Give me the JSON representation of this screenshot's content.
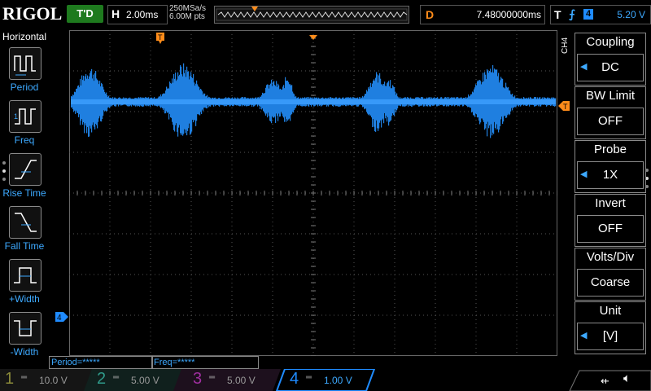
{
  "brand": "RIGOL",
  "run_state": "T'D",
  "horizontal": {
    "label": "H",
    "timebase": "2.00ms",
    "sample_rate": "250MSa/s",
    "points": "6.00M pts"
  },
  "delay": {
    "label": "D",
    "value": "7.48000000ms"
  },
  "trigger": {
    "label": "T",
    "edge_icon": "rising-edge-icon",
    "source": "4",
    "level": "5.20 V"
  },
  "left_menu": {
    "title": "Horizontal",
    "items": [
      {
        "label": "Period",
        "icon": "period-icon"
      },
      {
        "label": "Freq",
        "icon": "freq-icon"
      },
      {
        "label": "Rise Time",
        "icon": "rise-time-icon"
      },
      {
        "label": "Fall Time",
        "icon": "fall-time-icon"
      },
      {
        "label": "+Width",
        "icon": "pos-width-icon"
      },
      {
        "label": "-Width",
        "icon": "neg-width-icon"
      }
    ]
  },
  "right_menu": {
    "channel": "CH4",
    "items": [
      {
        "title": "Coupling",
        "value": "DC",
        "has_arrow": true
      },
      {
        "title": "BW Limit",
        "value": "OFF",
        "has_arrow": false
      },
      {
        "title": "Probe",
        "value": "1X",
        "has_arrow": true
      },
      {
        "title": "Invert",
        "value": "OFF",
        "has_arrow": false
      },
      {
        "title": "Volts/Div",
        "value": "Coarse",
        "has_arrow": false
      },
      {
        "title": "Unit",
        "value": "[V]",
        "has_arrow": true
      }
    ]
  },
  "measurements": [
    "Period=*****",
    "Freq=*****"
  ],
  "channels": [
    {
      "num": "1",
      "scale": "10.0 V",
      "color": "#8a8a3a"
    },
    {
      "num": "2",
      "scale": "5.00 V",
      "color": "#2f9a8a"
    },
    {
      "num": "3",
      "scale": "5.00 V",
      "color": "#a02fa0"
    },
    {
      "num": "4",
      "scale": "1.00 V",
      "color": "#1f8bff"
    }
  ],
  "channel4_marker": "4",
  "trace_color": "#1f7fe0"
}
